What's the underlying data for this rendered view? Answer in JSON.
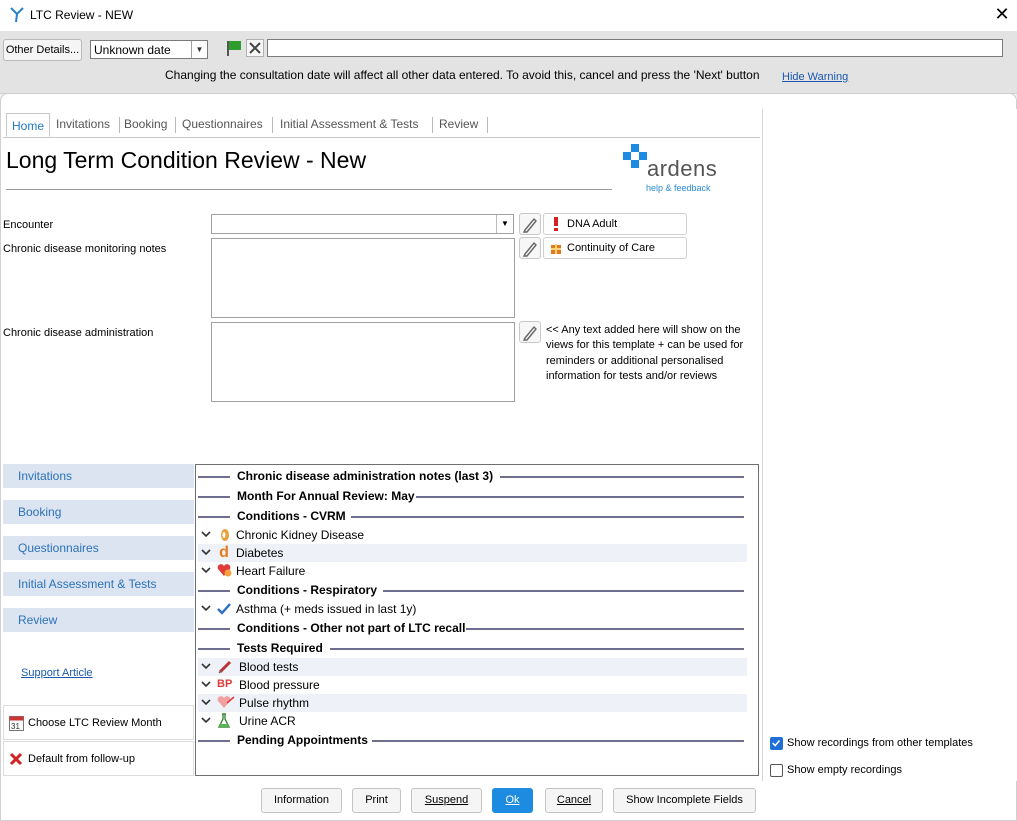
{
  "window": {
    "title": "LTC Review - NEW",
    "close_glyph": "✕"
  },
  "toolbar": {
    "other_details_label": "Other Details...",
    "date_value": "Unknown date",
    "warning_text": "Changing the consultation date will affect all other data entered. To avoid this, cancel and press the 'Next' button",
    "hide_warning_label": "Hide Warning",
    "flag_icon": "green-flag-icon",
    "clear_icon": "x-icon"
  },
  "tabs": [
    "Home",
    "Invitations",
    "Booking",
    "Questionnaires",
    "Initial Assessment & Tests",
    "Review"
  ],
  "header": {
    "title": "Long Term Condition Review - New",
    "logo_text": "ardens",
    "logo_help": "help & feedback"
  },
  "form": {
    "encounter_label": "Encounter",
    "encounter_value": "",
    "monitoring_label": "Chronic disease monitoring notes",
    "administration_label": "Chronic disease administration",
    "admin_note": "<< Any text added here will show on the views for this template + can be used for reminders or additional personalised information for tests and/or reviews",
    "chips": [
      {
        "label": "DNA Adult",
        "icon": "exclamation-icon"
      },
      {
        "label": "Continuity of Care",
        "icon": "gift-icon"
      }
    ]
  },
  "nav": [
    "Invitations",
    "Booking",
    "Questionnaires",
    "Initial Assessment & Tests",
    "Review"
  ],
  "support_article": "Support Article",
  "side_buttons": [
    {
      "label": "Choose LTC Review Month",
      "icon": "calendar-icon",
      "icon_text": "31"
    },
    {
      "label": "Default from follow-up",
      "icon": "red-x-icon"
    }
  ],
  "tree": {
    "headers": [
      "Chronic disease administration notes (last 3)",
      "Month For Annual Review: May",
      "Conditions - CVRM",
      "Conditions - Respiratory",
      "Conditions - Other not part of LTC recall",
      "Tests Required",
      "Pending Appointments"
    ],
    "cvrm": [
      {
        "label": "Chronic Kidney Disease",
        "icon": "kidney-icon"
      },
      {
        "label": "Diabetes",
        "icon": "diabetes-icon",
        "icon_text": "d"
      },
      {
        "label": "Heart Failure",
        "icon": "heart-failure-icon"
      }
    ],
    "respiratory": [
      {
        "label": "Asthma (+ meds issued in last 1y)",
        "icon": "check-icon"
      }
    ],
    "tests": [
      {
        "label": "Blood tests",
        "icon": "syringe-icon"
      },
      {
        "label": "Blood pressure",
        "icon": "bp-icon",
        "icon_text": "BP"
      },
      {
        "label": "Pulse rhythm",
        "icon": "pulse-heart-icon"
      },
      {
        "label": "Urine ACR",
        "icon": "flask-icon"
      }
    ]
  },
  "options": {
    "show_other_templates": {
      "label": "Show recordings from other templates",
      "checked": true
    },
    "show_empty": {
      "label": "Show empty recordings",
      "checked": false
    }
  },
  "buttons": {
    "information": "Information",
    "print": "Print",
    "suspend": "Suspend",
    "ok": "Ok",
    "cancel": "Cancel",
    "show_incomplete": "Show Incomplete Fields"
  },
  "colors": {
    "accent": "#1d8ce0",
    "nav_bg": "#dbe4f0",
    "nav_text": "#2b72b8",
    "link": "#1a58b0"
  }
}
